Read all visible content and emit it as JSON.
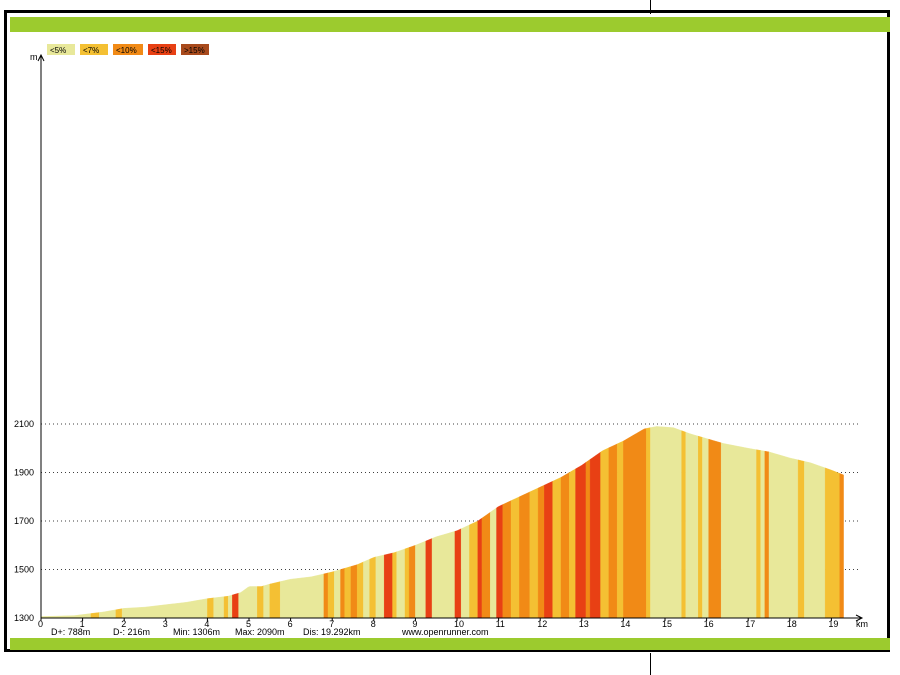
{
  "chart_data": {
    "type": "area",
    "y_unit_label": "m",
    "x_unit_label": "km",
    "ylim": [
      1300,
      2100
    ],
    "xlim": [
      0,
      19.292
    ],
    "y_ticks": [
      "1300",
      "1500",
      "1700",
      "1900",
      "2100"
    ],
    "x_ticks": [
      "0",
      "1",
      "2",
      "3",
      "4",
      "5",
      "6",
      "7",
      "8",
      "9",
      "10",
      "11",
      "12",
      "13",
      "14",
      "15",
      "16",
      "17",
      "18",
      "19"
    ],
    "legend": [
      {
        "label": "<5%",
        "color": "#e8e89a"
      },
      {
        "label": "<7%",
        "color": "#f4c033"
      },
      {
        "label": "<10%",
        "color": "#f18a16"
      },
      {
        "label": "<15%",
        "color": "#e84014"
      },
      {
        "label": ">15%",
        "color": "#a84a1c"
      }
    ],
    "profile": [
      [
        0,
        1306
      ],
      [
        0.8,
        1310
      ],
      [
        1.5,
        1325
      ],
      [
        2,
        1340
      ],
      [
        2.5,
        1345
      ],
      [
        3,
        1355
      ],
      [
        3.5,
        1365
      ],
      [
        4,
        1380
      ],
      [
        4.5,
        1390
      ],
      [
        4.8,
        1405
      ],
      [
        5,
        1430
      ],
      [
        5.3,
        1430
      ],
      [
        5.5,
        1440
      ],
      [
        6,
        1460
      ],
      [
        6.5,
        1470
      ],
      [
        7,
        1490
      ],
      [
        7.3,
        1505
      ],
      [
        7.6,
        1520
      ],
      [
        8,
        1550
      ],
      [
        8.5,
        1570
      ],
      [
        9,
        1600
      ],
      [
        9.5,
        1635
      ],
      [
        10,
        1660
      ],
      [
        10.5,
        1700
      ],
      [
        11,
        1760
      ],
      [
        11.5,
        1800
      ],
      [
        12,
        1840
      ],
      [
        12.5,
        1880
      ],
      [
        13,
        1930
      ],
      [
        13.5,
        1990
      ],
      [
        14,
        2030
      ],
      [
        14.5,
        2080
      ],
      [
        14.8,
        2090
      ],
      [
        15.2,
        2085
      ],
      [
        15.6,
        2060
      ],
      [
        16,
        2040
      ],
      [
        16.4,
        2020
      ],
      [
        17,
        2000
      ],
      [
        17.5,
        1985
      ],
      [
        18,
        1960
      ],
      [
        18.5,
        1940
      ],
      [
        19,
        1910
      ],
      [
        19.292,
        1890
      ]
    ],
    "segments": [
      [
        0,
        0.8,
        0
      ],
      [
        0.8,
        1.2,
        0
      ],
      [
        1.2,
        1.4,
        1
      ],
      [
        1.4,
        1.8,
        0
      ],
      [
        1.8,
        1.95,
        1
      ],
      [
        1.95,
        4,
        0
      ],
      [
        4,
        4.15,
        1
      ],
      [
        4.15,
        4.4,
        0
      ],
      [
        4.4,
        4.5,
        1
      ],
      [
        4.5,
        4.6,
        0
      ],
      [
        4.6,
        4.75,
        3
      ],
      [
        4.75,
        5.2,
        0
      ],
      [
        5.2,
        5.35,
        1
      ],
      [
        5.35,
        5.5,
        0
      ],
      [
        5.5,
        5.75,
        1
      ],
      [
        5.75,
        6.8,
        0
      ],
      [
        6.8,
        6.9,
        2
      ],
      [
        6.9,
        7.05,
        1
      ],
      [
        7.05,
        7.2,
        0
      ],
      [
        7.2,
        7.3,
        2
      ],
      [
        7.3,
        7.45,
        1
      ],
      [
        7.45,
        7.6,
        2
      ],
      [
        7.6,
        7.75,
        1
      ],
      [
        7.75,
        7.9,
        0
      ],
      [
        7.9,
        8.05,
        1
      ],
      [
        8.05,
        8.25,
        0
      ],
      [
        8.25,
        8.45,
        3
      ],
      [
        8.45,
        8.55,
        1
      ],
      [
        8.55,
        8.75,
        0
      ],
      [
        8.75,
        8.85,
        1
      ],
      [
        8.85,
        9.0,
        2
      ],
      [
        9.0,
        9.25,
        0
      ],
      [
        9.25,
        9.4,
        3
      ],
      [
        9.4,
        9.95,
        0
      ],
      [
        9.95,
        10.1,
        3
      ],
      [
        10.1,
        10.3,
        0
      ],
      [
        10.3,
        10.5,
        1
      ],
      [
        10.5,
        10.6,
        3
      ],
      [
        10.6,
        10.8,
        2
      ],
      [
        10.8,
        10.95,
        0
      ],
      [
        10.95,
        11.1,
        3
      ],
      [
        11.1,
        11.3,
        2
      ],
      [
        11.3,
        11.5,
        1
      ],
      [
        11.5,
        11.75,
        2
      ],
      [
        11.75,
        11.95,
        1
      ],
      [
        11.95,
        12.1,
        2
      ],
      [
        12.1,
        12.3,
        3
      ],
      [
        12.3,
        12.5,
        1
      ],
      [
        12.5,
        12.7,
        2
      ],
      [
        12.7,
        12.85,
        1
      ],
      [
        12.85,
        13.1,
        3
      ],
      [
        13.1,
        13.2,
        2
      ],
      [
        13.2,
        13.45,
        3
      ],
      [
        13.45,
        13.65,
        1
      ],
      [
        13.65,
        13.85,
        2
      ],
      [
        13.85,
        14.0,
        1
      ],
      [
        14.0,
        14.55,
        2
      ],
      [
        14.55,
        14.65,
        1
      ],
      [
        14.65,
        15.4,
        0
      ],
      [
        15.4,
        15.5,
        1
      ],
      [
        15.5,
        15.8,
        0
      ],
      [
        15.8,
        15.9,
        1
      ],
      [
        15.9,
        16.05,
        0
      ],
      [
        16.05,
        16.35,
        2
      ],
      [
        16.35,
        17.2,
        0
      ],
      [
        17.2,
        17.3,
        1
      ],
      [
        17.3,
        17.4,
        0
      ],
      [
        17.4,
        17.5,
        2
      ],
      [
        17.5,
        18.2,
        0
      ],
      [
        18.2,
        18.35,
        1
      ],
      [
        18.35,
        18.85,
        0
      ],
      [
        18.85,
        19.2,
        1
      ],
      [
        19.2,
        19.292,
        2
      ]
    ],
    "grid": "dotted"
  },
  "stats": {
    "d_plus": "D+: 788m",
    "d_minus": "D-: 216m",
    "min": "Min: 1306m",
    "max": "Max: 2090m",
    "dis": "Dis: 19.292km",
    "site": "www.openrunner.com"
  }
}
